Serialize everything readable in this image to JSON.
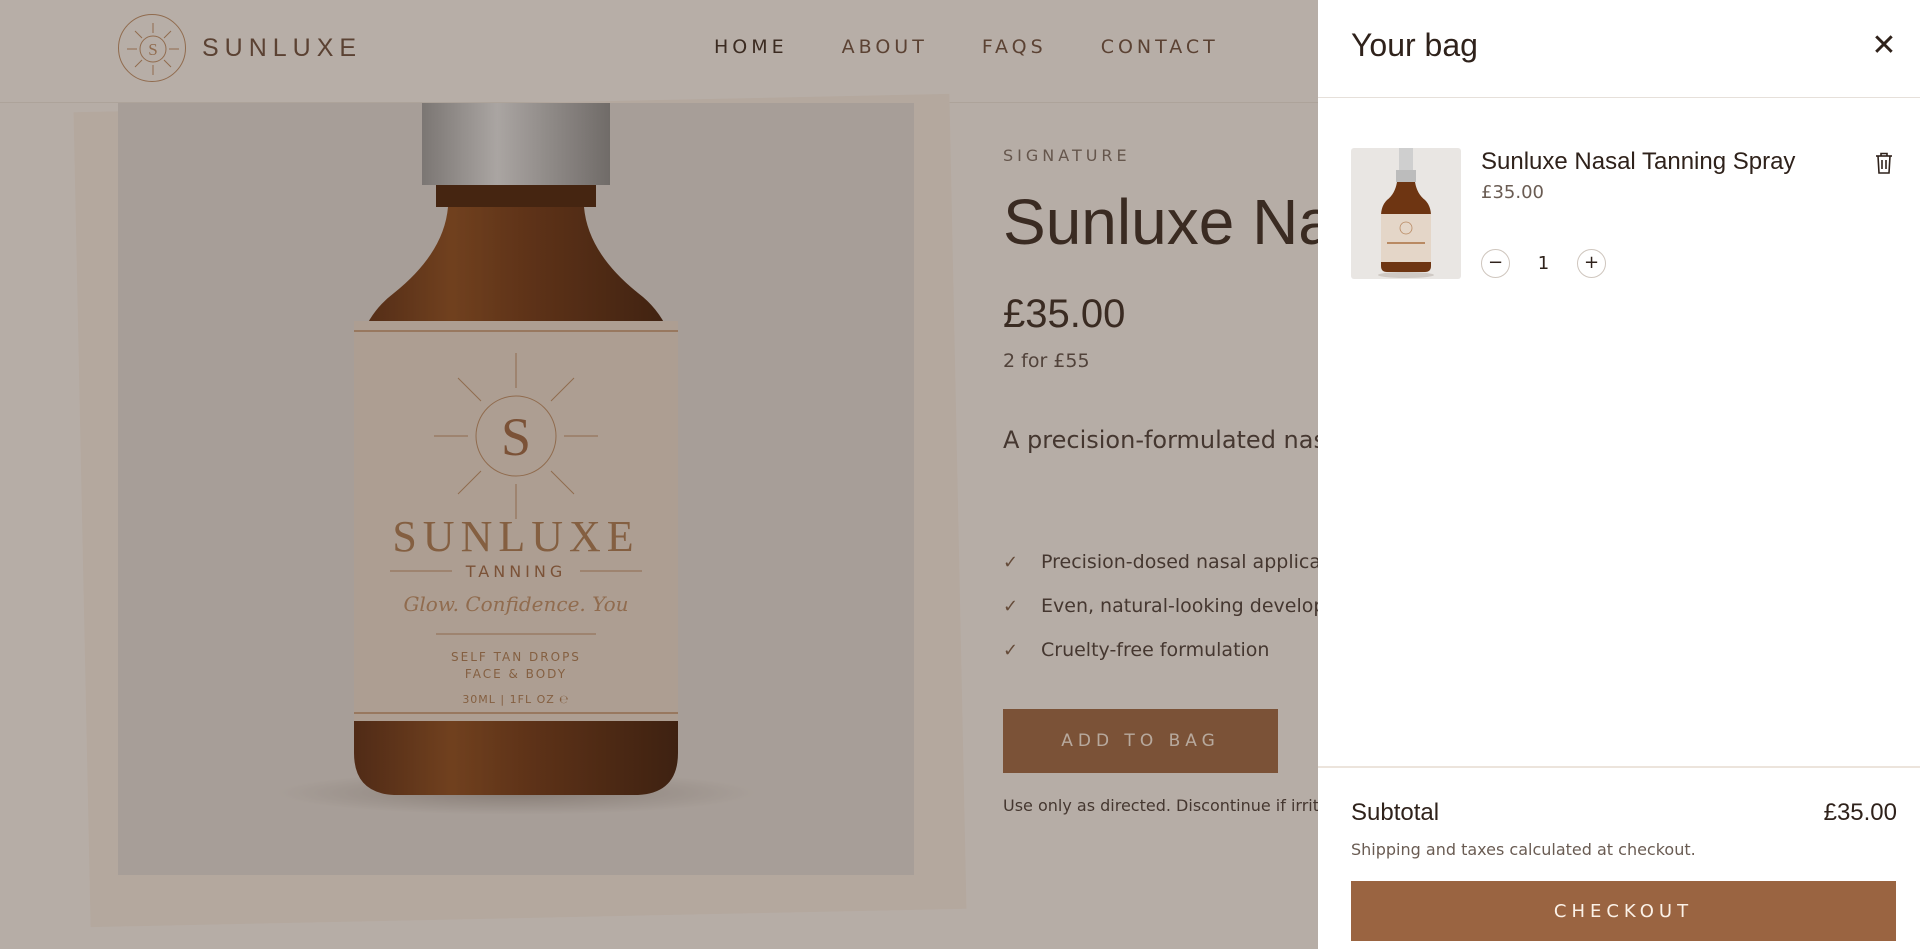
{
  "brand": {
    "name": "SUNLUXE",
    "logo_letter": "S"
  },
  "nav": {
    "items": [
      "HOME",
      "ABOUT",
      "FAQS",
      "CONTACT"
    ]
  },
  "product": {
    "eyebrow": "SIGNATURE",
    "title": "Sunluxe Nasal Tanning Spray",
    "price": "£35.00",
    "deal": "2 for £55",
    "description": "A precision-formulated nasal tanning response. Crafted for",
    "features": [
      "Precision-dosed nasal applicator",
      "Even, natural-looking development",
      "Cruelty-free formulation"
    ],
    "add_to_bag": "ADD TO BAG",
    "disclaimer": "Use only as directed. Discontinue if irritation"
  },
  "bottle_label": {
    "brand": "SUNLUXE",
    "sub": "TANNING",
    "script": "Glow. Confidence. You",
    "line1": "SELF TAN DROPS",
    "line2": "FACE & BODY",
    "volume": "30ML | 1FL OZ ℮"
  },
  "cart": {
    "title": "Your bag",
    "items": [
      {
        "name": "Sunluxe Nasal Tanning Spray",
        "price": "£35.00",
        "quantity": "1"
      }
    ],
    "subtotal_label": "Subtotal",
    "subtotal_value": "£35.00",
    "shipping_note": "Shipping and taxes calculated at checkout.",
    "checkout_label": "CHECKOUT"
  },
  "colors": {
    "accent": "#9a6441",
    "text": "#2f221b"
  },
  "icons": {
    "close": "close-icon",
    "trash": "trash-icon",
    "minus": "minus-icon",
    "plus": "plus-icon",
    "check": "check-icon"
  }
}
